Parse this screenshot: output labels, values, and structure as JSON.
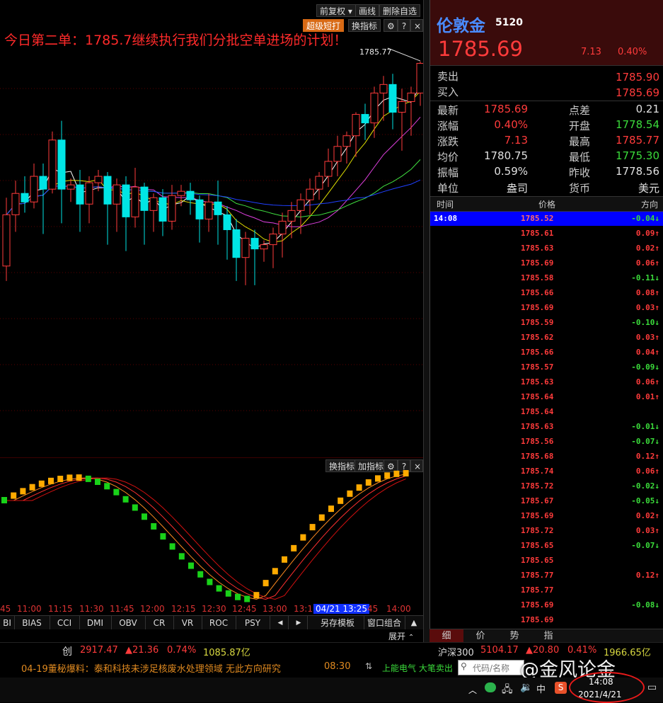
{
  "toolbar": {
    "restore": "前复权",
    "draw": "画线",
    "delete_watch": "删除自选",
    "super_shortcut": "超级短打",
    "switch_indicator": "换指标",
    "help": "?",
    "close": "×"
  },
  "headline": "今日第二单：1785.7继续执行我们分批空单进场的计划！",
  "peak_label": "1785.77",
  "sub_toolbar": {
    "switch_indicator": "换指标",
    "add_indicator": "加指标",
    "help": "?",
    "close": "×"
  },
  "time_axis": [
    "45",
    "11:00",
    "11:15",
    "11:30",
    "11:45",
    "12:00",
    "12:15",
    "12:30",
    "12:45",
    "13:00",
    "13:1",
    "45",
    "14:00"
  ],
  "time_cursor": "04/21 13:25",
  "indicator_tabs": [
    "BI",
    "BIAS",
    "CCI",
    "DMI",
    "OBV",
    "CR",
    "VR",
    "ROC",
    "PSY"
  ],
  "tab_controls": {
    "prev": "◀",
    "next": "▶",
    "template": "另存模板",
    "combo": "窗口组合",
    "up": "▲"
  },
  "expand": "展开",
  "quote": {
    "name": "伦敦金",
    "code": "5120",
    "price": "1785.69",
    "change": "7.13",
    "change_pct": "0.40%",
    "ask_label": "卖出",
    "ask": "1785.90",
    "bid_label": "买入",
    "bid": "1785.69",
    "stats": [
      {
        "l1": "最新",
        "v1": "1785.69",
        "c1": "red",
        "l2": "点差",
        "v2": "0.21",
        "c2": "white"
      },
      {
        "l1": "涨幅",
        "v1": "0.40%",
        "c1": "red",
        "l2": "开盘",
        "v2": "1778.54",
        "c2": "green"
      },
      {
        "l1": "涨跌",
        "v1": "7.13",
        "c1": "red",
        "l2": "最高",
        "v2": "1785.77",
        "c2": "red"
      },
      {
        "l1": "均价",
        "v1": "1780.75",
        "c1": "white",
        "l2": "最低",
        "v2": "1775.30",
        "c2": "green"
      },
      {
        "l1": "振幅",
        "v1": "0.59%",
        "c1": "white",
        "l2": "昨收",
        "v2": "1778.56",
        "c2": "white"
      },
      {
        "l1": "单位",
        "v1": "盎司",
        "c1": "white",
        "l2": "货币",
        "v2": "美元",
        "c2": "white"
      }
    ],
    "ticks_header": {
      "time": "时间",
      "price": "价格",
      "dir": "方向"
    },
    "ticks": [
      {
        "time": "14:08",
        "price": "1785.52",
        "dir": "-0.04↓",
        "color": "green"
      },
      {
        "time": "",
        "price": "1785.61",
        "dir": "0.09↑",
        "color": "red"
      },
      {
        "time": "",
        "price": "1785.63",
        "dir": "0.02↑",
        "color": "red"
      },
      {
        "time": "",
        "price": "1785.69",
        "dir": "0.06↑",
        "color": "red"
      },
      {
        "time": "",
        "price": "1785.58",
        "dir": "-0.11↓",
        "color": "green"
      },
      {
        "time": "",
        "price": "1785.66",
        "dir": "0.08↑",
        "color": "red"
      },
      {
        "time": "",
        "price": "1785.69",
        "dir": "0.03↑",
        "color": "red"
      },
      {
        "time": "",
        "price": "1785.59",
        "dir": "-0.10↓",
        "color": "green"
      },
      {
        "time": "",
        "price": "1785.62",
        "dir": "0.03↑",
        "color": "red"
      },
      {
        "time": "",
        "price": "1785.66",
        "dir": "0.04↑",
        "color": "red"
      },
      {
        "time": "",
        "price": "1785.57",
        "dir": "-0.09↓",
        "color": "green"
      },
      {
        "time": "",
        "price": "1785.63",
        "dir": "0.06↑",
        "color": "red"
      },
      {
        "time": "",
        "price": "1785.64",
        "dir": "0.01↑",
        "color": "red"
      },
      {
        "time": "",
        "price": "1785.64",
        "dir": "",
        "color": "red"
      },
      {
        "time": "",
        "price": "1785.63",
        "dir": "-0.01↓",
        "color": "green"
      },
      {
        "time": "",
        "price": "1785.56",
        "dir": "-0.07↓",
        "color": "green"
      },
      {
        "time": "",
        "price": "1785.68",
        "dir": "0.12↑",
        "color": "red"
      },
      {
        "time": "",
        "price": "1785.74",
        "dir": "0.06↑",
        "color": "red"
      },
      {
        "time": "",
        "price": "1785.72",
        "dir": "-0.02↓",
        "color": "green"
      },
      {
        "time": "",
        "price": "1785.67",
        "dir": "-0.05↓",
        "color": "green"
      },
      {
        "time": "",
        "price": "1785.69",
        "dir": "0.02↑",
        "color": "red"
      },
      {
        "time": "",
        "price": "1785.72",
        "dir": "0.03↑",
        "color": "red"
      },
      {
        "time": "",
        "price": "1785.65",
        "dir": "-0.07↓",
        "color": "green"
      },
      {
        "time": "",
        "price": "1785.65",
        "dir": "",
        "color": "red"
      },
      {
        "time": "",
        "price": "1785.77",
        "dir": "0.12↑",
        "color": "red"
      },
      {
        "time": "",
        "price": "1785.77",
        "dir": "",
        "color": "red"
      },
      {
        "time": "",
        "price": "1785.69",
        "dir": "-0.08↓",
        "color": "green"
      },
      {
        "time": "",
        "price": "1785.69",
        "dir": "",
        "color": "red"
      }
    ],
    "bottom_tabs": [
      "细",
      "价",
      "势",
      "指"
    ]
  },
  "status1": {
    "left_label": "创",
    "left_val": "2917.47",
    "left_chg": "▲21.36",
    "left_pct": "0.74%",
    "left_amt": "1085.87亿",
    "right_label": "沪深300",
    "right_val": "5104.17",
    "right_chg": "▲20.80",
    "right_pct": "0.41%",
    "right_amt": "1966.65亿"
  },
  "status2": {
    "news": "04-19董秘爆料：泰和科技未涉足核废水处理领域  无此方向研究",
    "news_time": "08:30",
    "ticker": "上能电气  大笔卖出",
    "search_placeholder": "代码/名称",
    "watermark": "@金风论金"
  },
  "taskbar": {
    "ime": "中",
    "time": "14:08",
    "date": "2021/4/21"
  },
  "colors": {
    "up": "#ff3b3b",
    "down": "#3bdc3b",
    "bear_candle": "#00e5e5",
    "accent_orange": "#d86a15",
    "highlight_row": "#0000ff"
  },
  "chart_data": {
    "type": "candlestick",
    "title": "今日第二单：1785.7继续执行我们分批空单进场的计划！",
    "x": [
      "10:45",
      "11:00",
      "11:15",
      "11:30",
      "11:45",
      "12:00",
      "12:15",
      "12:30",
      "12:45",
      "13:00",
      "13:15",
      "13:30",
      "13:45",
      "14:00"
    ],
    "annotations": [
      "1785.77"
    ],
    "candles": [
      {
        "o": 1776.2,
        "c": 1778.6,
        "h": 1779.4,
        "l": 1775.5
      },
      {
        "o": 1778.6,
        "c": 1779.6,
        "h": 1780.2,
        "l": 1777.8
      },
      {
        "o": 1779.6,
        "c": 1779.2,
        "h": 1780.4,
        "l": 1778.7
      },
      {
        "o": 1779.2,
        "c": 1780.4,
        "h": 1781.0,
        "l": 1778.9
      },
      {
        "o": 1780.4,
        "c": 1779.8,
        "h": 1781.0,
        "l": 1777.7
      },
      {
        "o": 1779.8,
        "c": 1782.1,
        "h": 1782.5,
        "l": 1779.6
      },
      {
        "o": 1782.1,
        "c": 1779.8,
        "h": 1783.0,
        "l": 1778.2
      },
      {
        "o": 1779.8,
        "c": 1780.0,
        "h": 1780.3,
        "l": 1779.2
      },
      {
        "o": 1780.0,
        "c": 1779.1,
        "h": 1780.7,
        "l": 1777.8
      },
      {
        "o": 1779.1,
        "c": 1780.1,
        "h": 1780.4,
        "l": 1778.2
      },
      {
        "o": 1780.1,
        "c": 1780.4,
        "h": 1780.7,
        "l": 1779.7
      },
      {
        "o": 1780.4,
        "c": 1779.1,
        "h": 1780.6,
        "l": 1777.2
      },
      {
        "o": 1779.1,
        "c": 1780.0,
        "h": 1780.3,
        "l": 1777.8
      },
      {
        "o": 1780.0,
        "c": 1778.5,
        "h": 1780.4,
        "l": 1776.9
      },
      {
        "o": 1778.5,
        "c": 1779.9,
        "h": 1780.8,
        "l": 1778.0
      },
      {
        "o": 1779.9,
        "c": 1778.8,
        "h": 1780.1,
        "l": 1777.2
      },
      {
        "o": 1778.8,
        "c": 1779.4,
        "h": 1779.6,
        "l": 1777.8
      },
      {
        "o": 1779.4,
        "c": 1778.3,
        "h": 1779.8,
        "l": 1777.6
      },
      {
        "o": 1778.3,
        "c": 1779.5,
        "h": 1780.0,
        "l": 1777.9
      },
      {
        "o": 1779.5,
        "c": 1779.7,
        "h": 1780.0,
        "l": 1779.0
      },
      {
        "o": 1779.7,
        "c": 1779.3,
        "h": 1780.1,
        "l": 1778.6
      },
      {
        "o": 1779.3,
        "c": 1778.4,
        "h": 1779.5,
        "l": 1777.3
      },
      {
        "o": 1778.4,
        "c": 1779.2,
        "h": 1779.6,
        "l": 1777.8
      },
      {
        "o": 1779.2,
        "c": 1778.6,
        "h": 1780.2,
        "l": 1777.2
      },
      {
        "o": 1778.6,
        "c": 1777.9,
        "h": 1779.0,
        "l": 1776.5
      },
      {
        "o": 1777.9,
        "c": 1776.6,
        "h": 1778.4,
        "l": 1775.5
      },
      {
        "o": 1776.6,
        "c": 1777.5,
        "h": 1777.8,
        "l": 1775.3
      },
      {
        "o": 1777.5,
        "c": 1777.0,
        "h": 1777.9,
        "l": 1775.3
      },
      {
        "o": 1777.0,
        "c": 1777.2,
        "h": 1777.4,
        "l": 1776.4
      },
      {
        "o": 1777.2,
        "c": 1777.7,
        "h": 1778.0,
        "l": 1776.1
      },
      {
        "o": 1777.7,
        "c": 1778.3,
        "h": 1778.7,
        "l": 1776.6
      },
      {
        "o": 1778.3,
        "c": 1778.8,
        "h": 1779.2,
        "l": 1777.5
      },
      {
        "o": 1778.8,
        "c": 1779.3,
        "h": 1779.6,
        "l": 1777.7
      },
      {
        "o": 1779.3,
        "c": 1779.8,
        "h": 1780.3,
        "l": 1778.6
      },
      {
        "o": 1779.8,
        "c": 1780.4,
        "h": 1780.6,
        "l": 1779.3
      },
      {
        "o": 1780.4,
        "c": 1781.1,
        "h": 1781.7,
        "l": 1779.9
      },
      {
        "o": 1781.1,
        "c": 1781.8,
        "h": 1782.3,
        "l": 1780.4
      },
      {
        "o": 1781.8,
        "c": 1782.3,
        "h": 1782.5,
        "l": 1781.0
      },
      {
        "o": 1782.3,
        "c": 1783.3,
        "h": 1783.4,
        "l": 1781.3
      },
      {
        "o": 1783.3,
        "c": 1782.9,
        "h": 1783.8,
        "l": 1782.1
      },
      {
        "o": 1782.9,
        "c": 1784.3,
        "h": 1784.6,
        "l": 1782.2
      },
      {
        "o": 1784.3,
        "c": 1784.7,
        "h": 1785.1,
        "l": 1783.0
      },
      {
        "o": 1784.7,
        "c": 1783.4,
        "h": 1785.2,
        "l": 1782.6
      },
      {
        "o": 1783.4,
        "c": 1783.9,
        "h": 1784.5,
        "l": 1781.6
      },
      {
        "o": 1783.9,
        "c": 1784.3,
        "h": 1784.6,
        "l": 1782.3
      },
      {
        "o": 1784.3,
        "c": 1785.69,
        "h": 1785.77,
        "l": 1783.7
      }
    ]
  }
}
